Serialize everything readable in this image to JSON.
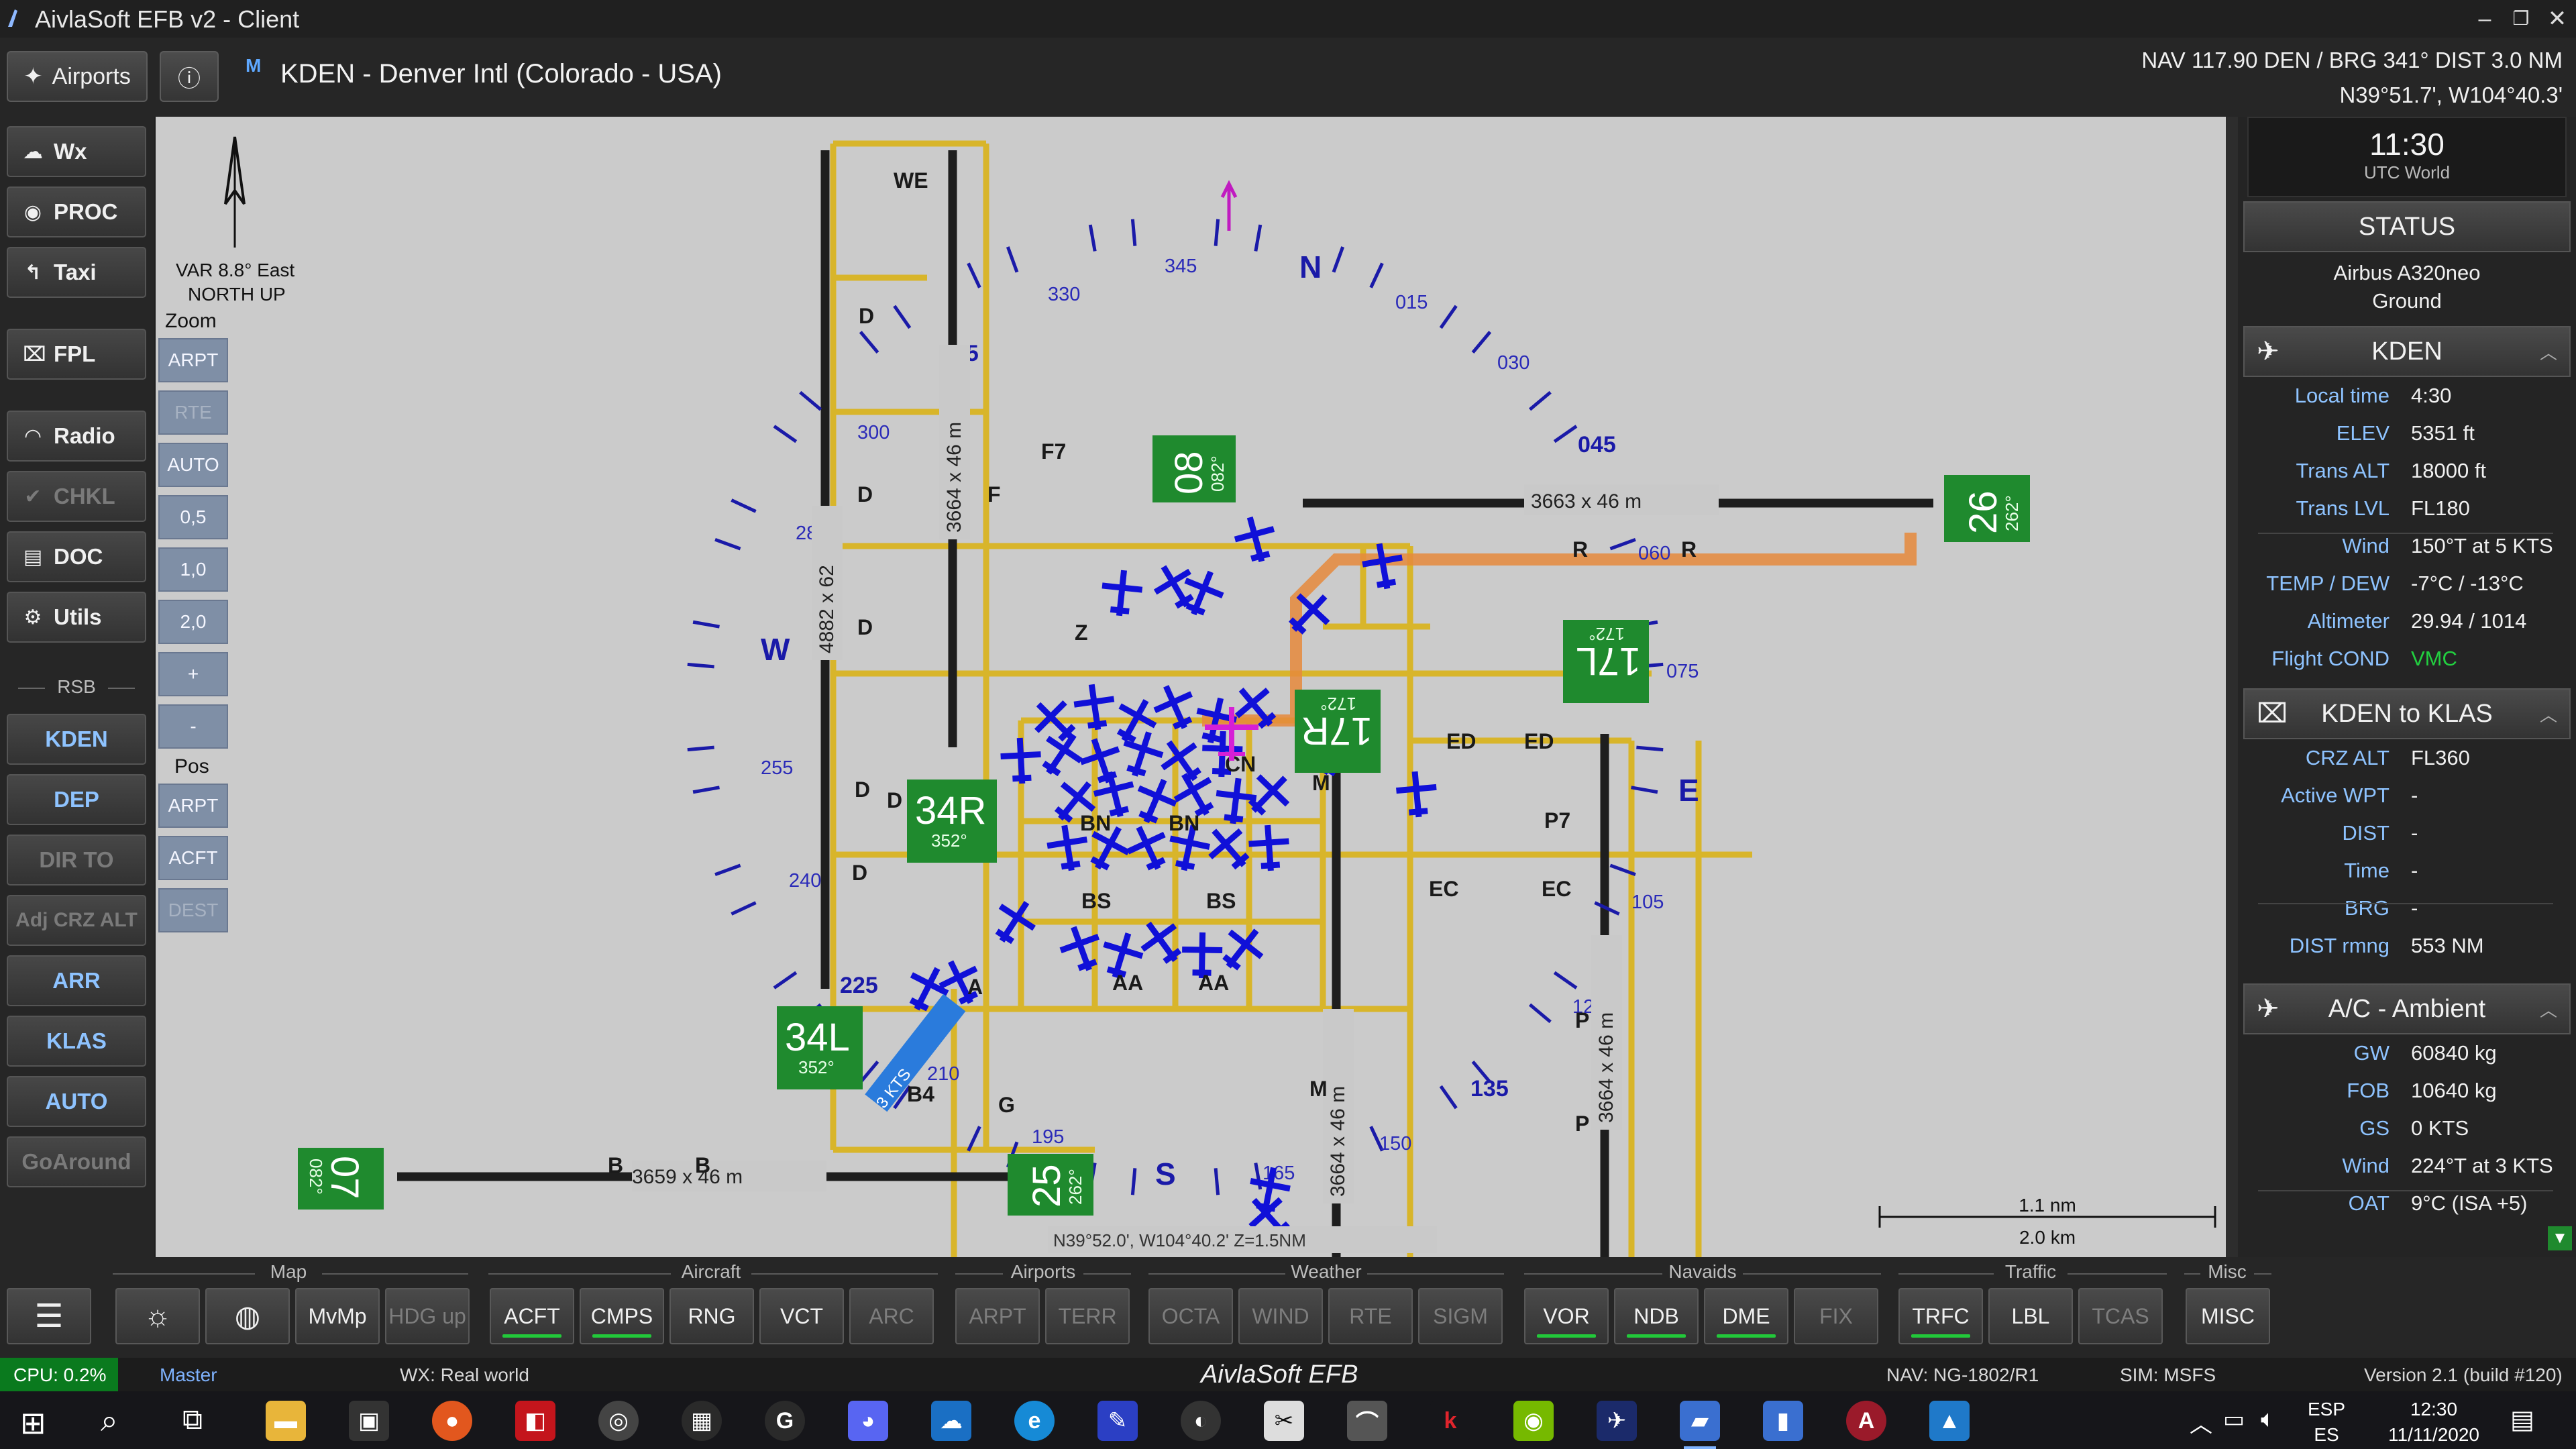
{
  "window": {
    "title": "AivlaSoft EFB v2 - Client"
  },
  "header": {
    "airports_button": "Airports",
    "info_button": "ⓘ",
    "m_badge": "M",
    "airport_name": "KDEN - Denver Intl (Colorado - USA)",
    "nav_line1": "NAV 117.90 DEN / BRG 341°  DIST 3.0 NM",
    "nav_line2": "N39°51.7', W104°40.3'"
  },
  "sidebar": {
    "wx": "Wx",
    "proc": "PROC",
    "taxi": "Taxi",
    "fpl": "FPL",
    "radio": "Radio",
    "chkl": "CHKL",
    "doc": "DOC",
    "utils": "Utils",
    "rsb": "RSB",
    "kden": "KDEN",
    "dep": "DEP",
    "dir_to": "DIR TO",
    "adj_crz_alt": "Adj CRZ ALT",
    "arr": "ARR",
    "klas": "KLAS",
    "auto": "AUTO",
    "goaround": "GoAround"
  },
  "map": {
    "var_text": "VAR 8.8° East",
    "north_up": "NORTH UP",
    "zoom_label": "Zoom",
    "zoom_buttons": [
      "ARPT",
      "RTE",
      "AUTO",
      "0,5",
      "1,0",
      "2,0",
      "+",
      "-"
    ],
    "pos_label": "Pos",
    "pos_buttons": [
      "ARPT",
      "ACFT",
      "DEST"
    ],
    "compass": {
      "N": "N",
      "E": "E",
      "S": "S",
      "W": "W",
      "d015": "015",
      "d030": "030",
      "d045": "045",
      "d060": "060",
      "d075": "075",
      "d105": "105",
      "d120": "120",
      "d135": "135",
      "d150": "150",
      "d165": "165",
      "d195": "195",
      "d210": "210",
      "d225": "225",
      "d240": "240",
      "d255": "255",
      "d285": "285",
      "d300": "300",
      "d315": "315",
      "d330": "330",
      "d345": "345"
    },
    "runway_dims": {
      "r08_26": "3663 x 46 m",
      "r07_25": "3659 x 46 m",
      "r34r": "3664 x 46 m",
      "r34l": "4882 x 62",
      "r17l": "3664 x 46 m",
      "r17r": "3664 x 46 m"
    },
    "runways": {
      "r08": "08",
      "r08_hdg": "082°",
      "r26": "26",
      "r26_hdg": "262°",
      "r17l": "17L",
      "r17l_hdg": "172°",
      "r17r": "17R",
      "r17r_hdg": "172°",
      "r34r": "34R",
      "r34r_hdg": "352°",
      "r34l": "34L",
      "r34l_hdg": "352°",
      "r07": "07",
      "r07_hdg": "082°",
      "r25": "25",
      "r25_hdg": "262°"
    },
    "taxiways": {
      "we": "WE",
      "d1": "D",
      "d2": "D",
      "d3": "D",
      "d4": "D",
      "d5": "D",
      "d6": "D",
      "f": "F",
      "f7": "F7",
      "z": "Z",
      "r1": "R",
      "r2": "R",
      "ed1": "ED",
      "ed2": "ED",
      "p7": "P7",
      "ec1": "EC",
      "ec2": "EC",
      "p1": "P",
      "p2": "P",
      "m1": "M",
      "m2": "M",
      "b": "B",
      "b_2": "B",
      "b4": "B4",
      "g": "G",
      "a": "A",
      "aa1": "AA",
      "aa2": "AA",
      "bn1": "BN",
      "bn2": "BN",
      "bs1": "BS",
      "bs2": "BS",
      "cn": "CN"
    },
    "wind_kts": "3 KTS",
    "coord_readout": "N39°52.0', W104°40.2' Z=1.5NM",
    "scale_nm": "1.1 nm",
    "scale_km": "2.0 km"
  },
  "right": {
    "time": "11:30",
    "time_sub": "UTC World",
    "status_title": "STATUS",
    "aircraft": "Airbus A320neo",
    "phase": "Ground",
    "airport_title": "KDEN",
    "airport_rows": [
      {
        "k": "Local time",
        "v": "4:30"
      },
      {
        "k": "ELEV",
        "v": "5351 ft"
      },
      {
        "k": "Trans ALT",
        "v": "18000 ft"
      },
      {
        "k": "Trans LVL",
        "v": "FL180"
      },
      {
        "k": "Wind",
        "v": "150°T at 5 KTS"
      },
      {
        "k": "TEMP / DEW",
        "v": "-7°C  /  -13°C"
      },
      {
        "k": "Altimeter",
        "v": "29.94 / 1014"
      },
      {
        "k": "Flight COND",
        "v": "VMC"
      }
    ],
    "route_title": "KDEN to KLAS",
    "route_rows": [
      {
        "k": "CRZ ALT",
        "v": "FL360"
      },
      {
        "k": "Active WPT",
        "v": "-"
      },
      {
        "k": "DIST",
        "v": "-"
      },
      {
        "k": "Time",
        "v": "-"
      },
      {
        "k": "BRG",
        "v": "-"
      },
      {
        "k": "DIST rmng",
        "v": "553 NM"
      }
    ],
    "ambient_title": "A/C - Ambient",
    "ambient_rows": [
      {
        "k": "GW",
        "v": "60840 kg"
      },
      {
        "k": "FOB",
        "v": "10640 kg"
      },
      {
        "k": "GS",
        "v": "0 KTS"
      },
      {
        "k": "Wind",
        "v": "224°T at 3 KTS"
      },
      {
        "k": "OAT",
        "v": "9°C (ISA +5)"
      }
    ]
  },
  "toolbar": {
    "groups": {
      "map": "Map",
      "aircraft": "Aircraft",
      "airports": "Airports",
      "weather": "Weather",
      "navaids": "Navaids",
      "traffic": "Traffic",
      "misc": "Misc"
    },
    "mvmp": "MvMp",
    "hdg_up": "HDG up",
    "acft": "ACFT",
    "cmps": "CMPS",
    "rng": "RNG",
    "vct": "VCT",
    "arc": "ARC",
    "arpt": "ARPT",
    "terr": "TERR",
    "octa": "OCTA",
    "wind": "WIND",
    "rte": "RTE",
    "sigm": "SIGM",
    "vor": "VOR",
    "ndb": "NDB",
    "dme": "DME",
    "fix": "FIX",
    "trfc": "TRFC",
    "lbl": "LBL",
    "tcas": "TCAS",
    "misc": "MISC"
  },
  "statusbar": {
    "cpu": "CPU: 0.2%",
    "master": "Master",
    "wx": "WX: Real world",
    "brand": "AivlaSoft EFB",
    "nav": "NAV: NG-1802/R1",
    "sim": "SIM: MSFS",
    "version": "Version 2.1 (build #120)"
  },
  "taskbar": {
    "lang1": "ESP",
    "lang2": "ES",
    "time": "12:30",
    "date": "11/11/2020"
  }
}
